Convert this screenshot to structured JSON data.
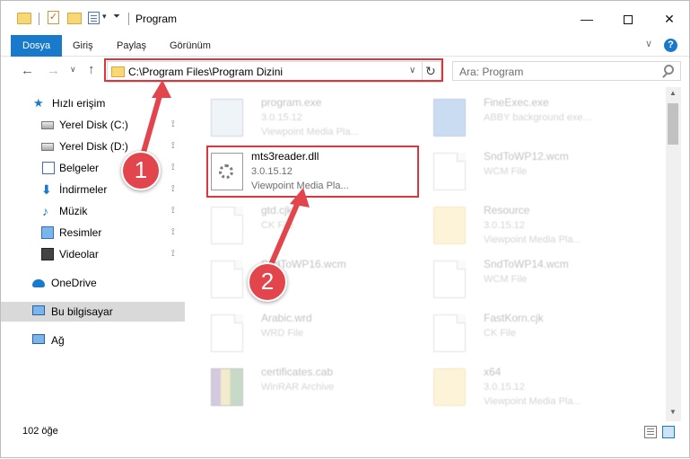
{
  "window": {
    "title": "Program",
    "minimize_symbol": "—",
    "close_symbol": "✕"
  },
  "ribbon": {
    "tabs": [
      "Dosya",
      "Giriş",
      "Paylaş",
      "Görünüm"
    ],
    "help_symbol": "?",
    "collapse_symbol": "∨"
  },
  "nav": {
    "back_symbol": "←",
    "forward_symbol": "→",
    "recent_symbol": "∨",
    "up_symbol": "↑",
    "address": "C:\\Program Files\\Program Dizini",
    "address_dropdown_symbol": "∨",
    "refresh_symbol": "↻",
    "search_placeholder": "Ara: Program"
  },
  "sidebar": {
    "quick_access": "Hızlı erişim",
    "items": [
      {
        "label": "Yerel Disk (C:)",
        "icon": "drive-icon",
        "pinned": true
      },
      {
        "label": "Yerel Disk (D:)",
        "icon": "drive-icon",
        "pinned": true
      },
      {
        "label": "Belgeler",
        "icon": "documents-icon",
        "pinned": true
      },
      {
        "label": "İndirmeler",
        "icon": "downloads-icon",
        "pinned": true
      },
      {
        "label": "Müzik",
        "icon": "music-icon",
        "pinned": true
      },
      {
        "label": "Resimler",
        "icon": "pictures-icon",
        "pinned": true
      },
      {
        "label": "Videolar",
        "icon": "videos-icon",
        "pinned": true
      }
    ],
    "onedrive": "OneDrive",
    "this_pc": "Bu bilgisayar",
    "network": "Ağ",
    "pin_symbol": "📌"
  },
  "files": [
    {
      "name": "program.exe",
      "version": "3.0.15.12",
      "type": "Viewpoint Media Pla...",
      "icon": "exe-icon",
      "faded": true
    },
    {
      "name": "FineExec.exe",
      "version": "",
      "type": "ABBY background exe...",
      "icon": "exe-blue-icon",
      "faded": true
    },
    {
      "name": "mts3reader.dll",
      "version": "3.0.15.12",
      "type": "Viewpoint Media Pla...",
      "icon": "dll-gear-icon",
      "faded": false
    },
    {
      "name": "SndToWP12.wcm",
      "version": "",
      "type": "WCM File",
      "icon": "file-icon",
      "faded": true
    },
    {
      "name": "gtd.cjk",
      "version": "",
      "type": "CK File",
      "icon": "file-icon",
      "faded": true
    },
    {
      "name": "Resource",
      "version": "3.0.15.12",
      "type": "Viewpoint Media Pla...",
      "icon": "folder-icon",
      "faded": true
    },
    {
      "name": "SndToWP16.wcm",
      "version": "",
      "type": "File",
      "icon": "file-icon",
      "faded": true
    },
    {
      "name": "SndToWP14.wcm",
      "version": "",
      "type": "WCM File",
      "icon": "file-icon",
      "faded": true
    },
    {
      "name": "Arabic.wrd",
      "version": "",
      "type": "WRD File",
      "icon": "file-icon",
      "faded": true
    },
    {
      "name": "FastKorn.cjk",
      "version": "",
      "type": "CK File",
      "icon": "file-icon",
      "faded": true
    },
    {
      "name": "certificates.cab",
      "version": "",
      "type": "WinRAR Archive",
      "icon": "archive-icon",
      "faded": true
    },
    {
      "name": "x64",
      "version": "3.0.15.12",
      "type": "Viewpoint Media Pla...",
      "icon": "folder-icon",
      "faded": true
    }
  ],
  "status": {
    "count": "102 öğe"
  },
  "annotations": {
    "step1": "1",
    "step2": "2",
    "color": "#d9363e"
  },
  "colors": {
    "accent": "#1979ca",
    "highlight_red": "#d9363e"
  }
}
